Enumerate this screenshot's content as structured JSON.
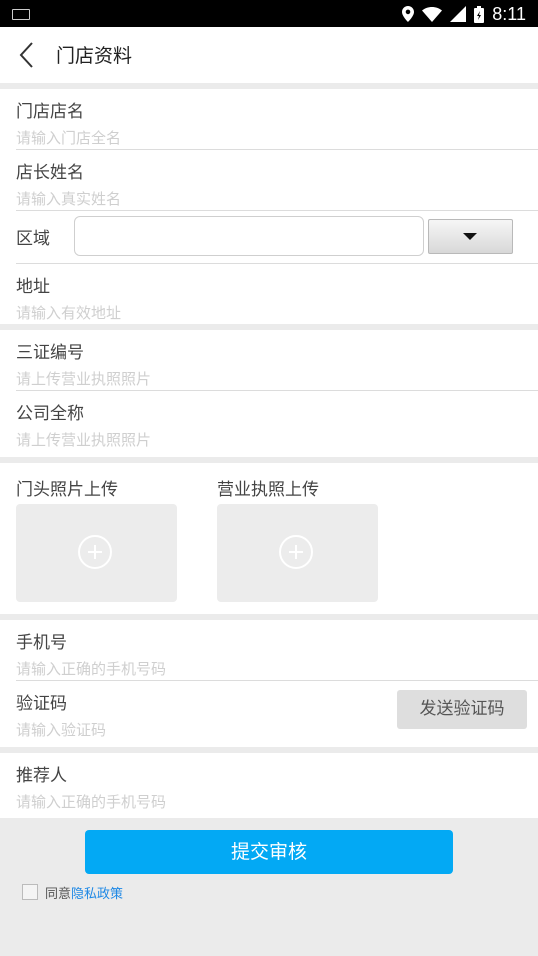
{
  "status_bar": {
    "time": "8:11"
  },
  "header": {
    "title": "门店资料"
  },
  "store_info": {
    "store_name": {
      "label": "门店店名",
      "placeholder": "请输入门店全名"
    },
    "manager_name": {
      "label": "店长姓名",
      "placeholder": "请输入真实姓名"
    },
    "region": {
      "label": "区域",
      "value": ""
    },
    "address": {
      "label": "地址",
      "placeholder": "请输入有效地址"
    }
  },
  "license_info": {
    "cert_number": {
      "label": "三证编号",
      "placeholder": "请上传营业执照照片"
    },
    "company_name": {
      "label": "公司全称",
      "placeholder": "请上传营业执照照片"
    }
  },
  "uploads": {
    "storefront": {
      "label": "门头照片上传"
    },
    "business_license": {
      "label": "营业执照上传"
    }
  },
  "contact": {
    "phone": {
      "label": "手机号",
      "placeholder": "请输入正确的手机号码"
    },
    "verify_code": {
      "label": "验证码",
      "placeholder": "请输入验证码",
      "send_button": "发送验证码"
    }
  },
  "referrer": {
    "label": "推荐人",
    "placeholder": "请输入正确的手机号码"
  },
  "footer": {
    "submit_label": "提交审核",
    "agree_text": "同意",
    "privacy_link": "隐私政策"
  },
  "colors": {
    "accent": "#03a9f4",
    "link": "#1e88e5"
  }
}
